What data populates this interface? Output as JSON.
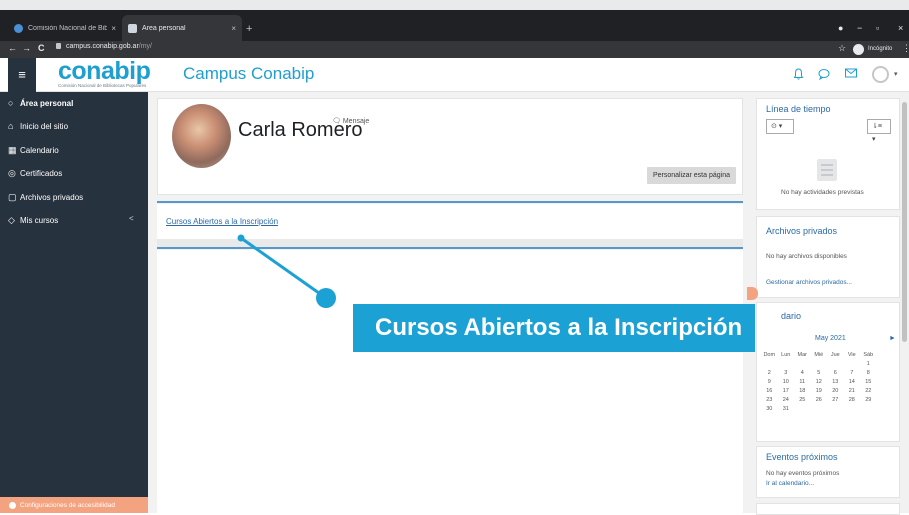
{
  "browser": {
    "tabs": [
      {
        "label": "Comisión Nacional de Bibliotec...",
        "close": "×"
      },
      {
        "label": "Área personal",
        "close": "×"
      }
    ],
    "new_tab": "+",
    "window_controls": {
      "minimize": "−",
      "restore": "▫",
      "close": "×"
    },
    "nav": {
      "back": "←",
      "forward": "→",
      "reload": "C"
    },
    "url": {
      "host": "campus.conabip.gob.ar",
      "path": "/my/"
    },
    "bookmark_star": "☆",
    "incognito_label": "Incógnito",
    "menu": "⋮"
  },
  "header": {
    "menu_icon": "≡",
    "logo_word": "conabip",
    "logo_sub": "Comisión Nacional de Bibliotecas Populares",
    "site_name": "Campus Conabip",
    "icons": [
      "bell-icon",
      "chat-icon",
      "mail-icon",
      "user-icon"
    ],
    "caret": "▾"
  },
  "sidebar": {
    "items": [
      {
        "label": "Área personal",
        "icon": "○"
      },
      {
        "label": "Inicio del sitio",
        "icon": "⌂"
      },
      {
        "label": "Calendario",
        "icon": "▦"
      },
      {
        "label": "Certificados",
        "icon": "◎"
      },
      {
        "label": "Archivos privados",
        "icon": "▢"
      },
      {
        "label": "Mis cursos",
        "icon": "◇"
      }
    ],
    "chevron": "<",
    "accessibility_label": "Configuraciones de accesibilidad"
  },
  "profile": {
    "name": "Carla Romero",
    "message_label": "Mensaje",
    "customise_button": "Personalizar esta página"
  },
  "courses_block": {
    "link_text": "Cursos Abiertos a la Inscripción"
  },
  "timeline": {
    "title": "Línea de tiempo",
    "filter_icon": "⊙ ▾",
    "sort_icon": "⇂≡ ▾",
    "empty_text": "No hay actividades previstas"
  },
  "private_files": {
    "title": "Archivos privados",
    "empty_text": "No hay archivos disponibles",
    "manage_link": "Gestionar archivos privados..."
  },
  "calendar": {
    "title": "dario",
    "month": "May 2021",
    "next": "►",
    "weekdays": [
      "Dom",
      "Lun",
      "Mar",
      "Mié",
      "Jue",
      "Vie",
      "Sáb"
    ],
    "weeks": [
      [
        "",
        "",
        "",
        "",
        "",
        "",
        "1"
      ],
      [
        "2",
        "3",
        "4",
        "5",
        "6",
        "7",
        "8"
      ],
      [
        "9",
        "10",
        "11",
        "12",
        "13",
        "14",
        "15"
      ],
      [
        "16",
        "17",
        "18",
        "19",
        "20",
        "21",
        "22"
      ],
      [
        "23",
        "24",
        "25",
        "26",
        "27",
        "28",
        "29"
      ],
      [
        "30",
        "31",
        "",
        "",
        "",
        "",
        ""
      ]
    ]
  },
  "upcoming": {
    "title": "Eventos próximos",
    "empty_text": "No hay eventos próximos",
    "calendar_link": "Ir al calendario..."
  },
  "overlay": {
    "callout_text": "Cursos Abiertos a la Inscripción",
    "accent_color": "#1ca1d4"
  }
}
